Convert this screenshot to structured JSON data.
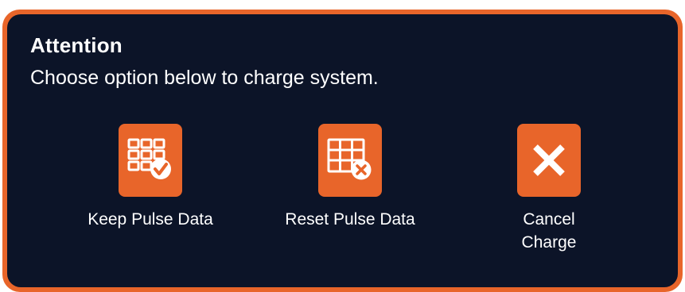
{
  "dialog": {
    "title": "Attention",
    "message": "Choose option below to charge system.",
    "options": [
      {
        "label": "Keep Pulse Data",
        "icon": "grid-check-icon"
      },
      {
        "label": "Reset Pulse Data",
        "icon": "grid-x-icon"
      },
      {
        "label": "Cancel Charge",
        "icon": "close-icon"
      }
    ]
  },
  "colors": {
    "accent": "#e8652a",
    "background": "#0c1428",
    "text": "#ffffff"
  }
}
